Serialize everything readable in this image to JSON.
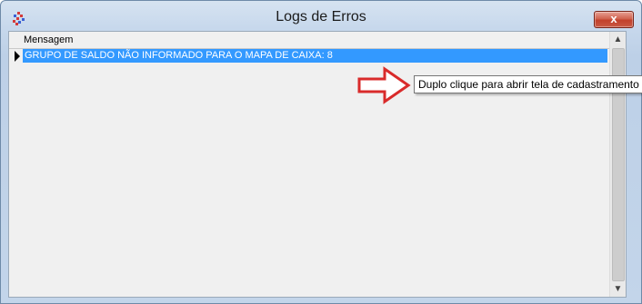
{
  "window": {
    "title": "Logs de Erros",
    "close_label": "x"
  },
  "grid": {
    "columns": [
      "Mensagem"
    ],
    "rows": [
      "GRUPO DE SALDO NÃO INFORMADO PARA O MAPA DE CAIXA: 8"
    ]
  },
  "scrollbar": {
    "up_label": "▲",
    "down_label": "▼"
  },
  "tooltip": {
    "text": "Duplo clique para abrir tela de cadastramento"
  },
  "colors": {
    "selection": "#3399ff",
    "annotation_arrow": "#d92b2b",
    "close_button": "#c2402b"
  }
}
